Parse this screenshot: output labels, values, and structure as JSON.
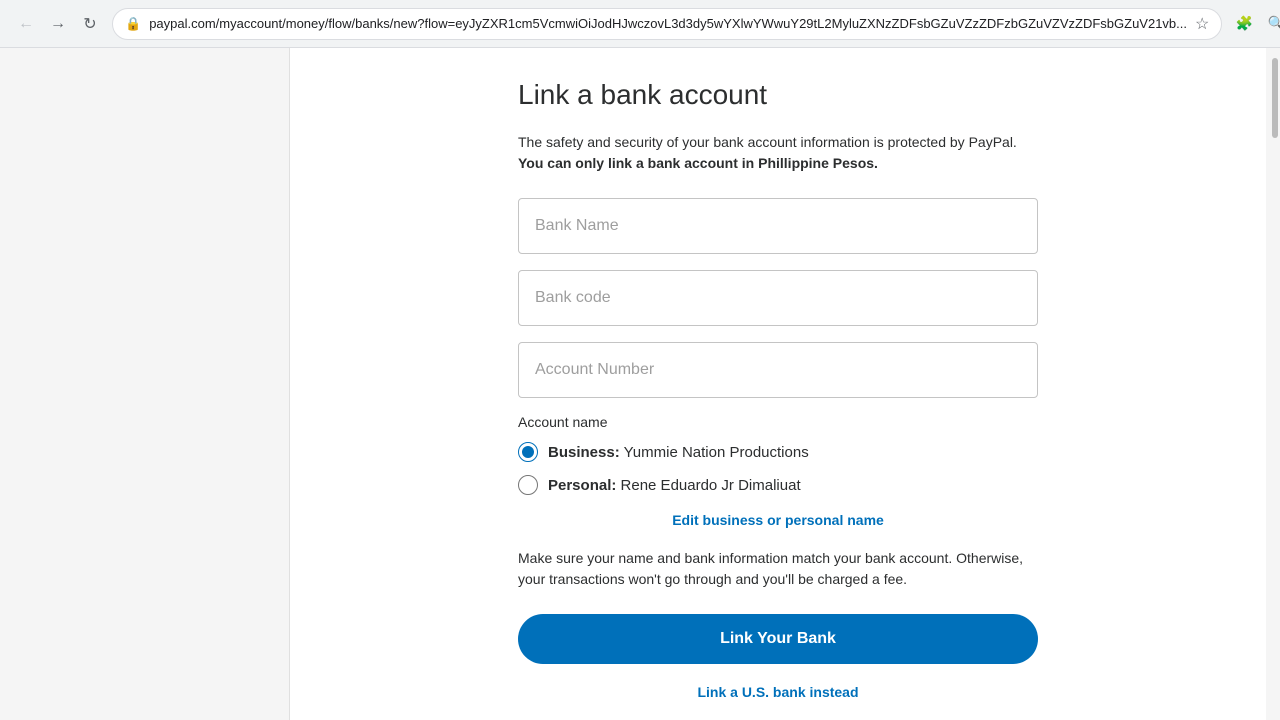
{
  "browser": {
    "url": "paypal.com/myaccount/money/flow/banks/new?flow=eyJyZXR1cm5VcmwiOiJodHJwczovL3d3dy5wYXlwYWwuY29tL2MyluZXNzZDFsbGZuVZzZDFzbGZuVZVzZDFsbGZuV21vb..."
  },
  "page": {
    "title": "Link a bank account",
    "description_part1": "The safety and security of your bank account information is protected by PayPal.",
    "description_part2": " You can only link a bank account in Phillippine Pesos.",
    "fields": {
      "bank_name_placeholder": "Bank Name",
      "bank_code_placeholder": "Bank code",
      "account_number_placeholder": "Account Number"
    },
    "account_name_label": "Account name",
    "radio_options": [
      {
        "id": "business",
        "label_strong": "Business:",
        "label_rest": " Yummie Nation Productions",
        "checked": true
      },
      {
        "id": "personal",
        "label_strong": "Personal:",
        "label_rest": " Rene Eduardo Jr Dimaliuat",
        "checked": false
      }
    ],
    "edit_link": "Edit business or personal name",
    "warning_text": "Make sure your name and bank information match your bank account. Otherwise, your transactions won't go through and you'll be charged a fee.",
    "link_bank_button": "Link Your Bank",
    "us_bank_link": "Link a U.S. bank instead"
  }
}
